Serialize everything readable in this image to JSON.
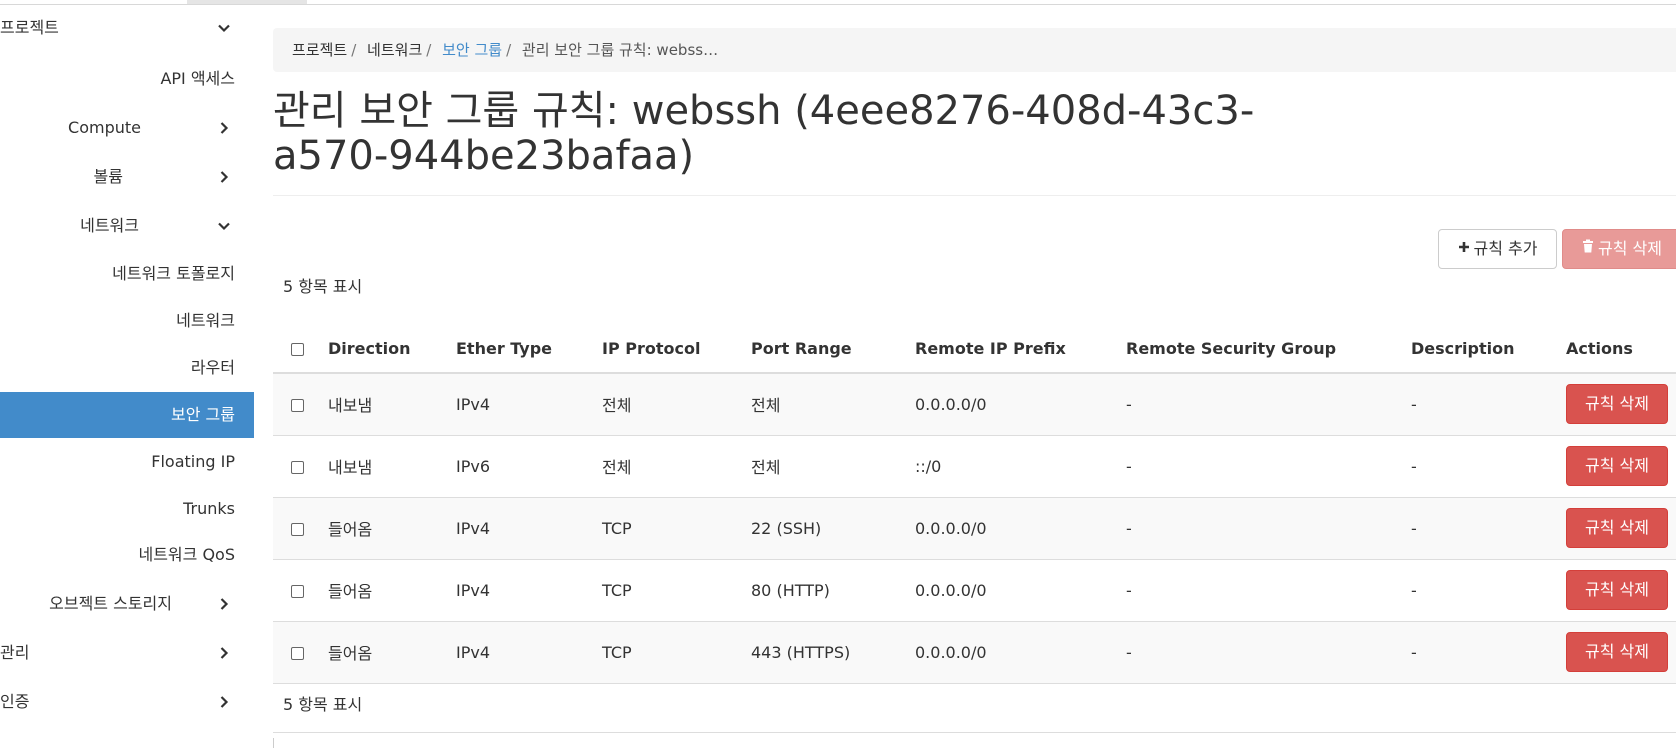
{
  "sidebar": {
    "project": "프로젝트",
    "api_access": "API 액세스",
    "compute": "Compute",
    "volume": "볼륨",
    "network": "네트워크",
    "network_topology": "네트워크 토폴로지",
    "networks": "네트워크",
    "router": "라우터",
    "security_groups": "보안 그룹",
    "floating_ip": "Floating IP",
    "trunks": "Trunks",
    "network_qos": "네트워크 QoS",
    "object_storage": "오브젝트 스토리지",
    "admin": "관리",
    "identity": "인증"
  },
  "breadcrumb": {
    "items": [
      "프로젝트",
      "네트워크",
      "보안 그룹",
      "관리 보안 그룹 규칙: webss…"
    ],
    "separator": "/"
  },
  "page": {
    "title_line1": "관리 보안 그룹 규칙: webssh (4eee8276-408d-43c3-",
    "title_line2": "a570-944be23bafaa)"
  },
  "toolbar": {
    "add_rule": "규칙 추가",
    "delete_rules": "규칙 삭제"
  },
  "table": {
    "count_top": "5 항목 표시",
    "count_bottom": "5 항목 표시",
    "headers": [
      "Direction",
      "Ether Type",
      "IP Protocol",
      "Port Range",
      "Remote IP Prefix",
      "Remote Security Group",
      "Description",
      "Actions"
    ],
    "rows": [
      {
        "direction": "내보냄",
        "ether": "IPv4",
        "protocol": "전체",
        "port": "전체",
        "prefix": "0.0.0.0/0",
        "group": "-",
        "desc": "-",
        "action": "규칙 삭제"
      },
      {
        "direction": "내보냄",
        "ether": "IPv6",
        "protocol": "전체",
        "port": "전체",
        "prefix": "::/0",
        "group": "-",
        "desc": "-",
        "action": "규칙 삭제"
      },
      {
        "direction": "들어옴",
        "ether": "IPv4",
        "protocol": "TCP",
        "port": "22 (SSH)",
        "prefix": "0.0.0.0/0",
        "group": "-",
        "desc": "-",
        "action": "규칙 삭제"
      },
      {
        "direction": "들어옴",
        "ether": "IPv4",
        "protocol": "TCP",
        "port": "80 (HTTP)",
        "prefix": "0.0.0.0/0",
        "group": "-",
        "desc": "-",
        "action": "규칙 삭제"
      },
      {
        "direction": "들어옴",
        "ether": "IPv4",
        "protocol": "TCP",
        "port": "443 (HTTPS)",
        "prefix": "0.0.0.0/0",
        "group": "-",
        "desc": "-",
        "action": "규칙 삭제"
      }
    ]
  },
  "icons": {
    "chevron_down": "chevron-down-icon",
    "chevron_right": "chevron-right-icon",
    "plus": "plus-icon",
    "trash": "trash-icon"
  },
  "colors": {
    "active_nav": "#428bca",
    "link": "#428bca",
    "danger": "#d9534f",
    "danger_disabled": "#e89a98"
  }
}
